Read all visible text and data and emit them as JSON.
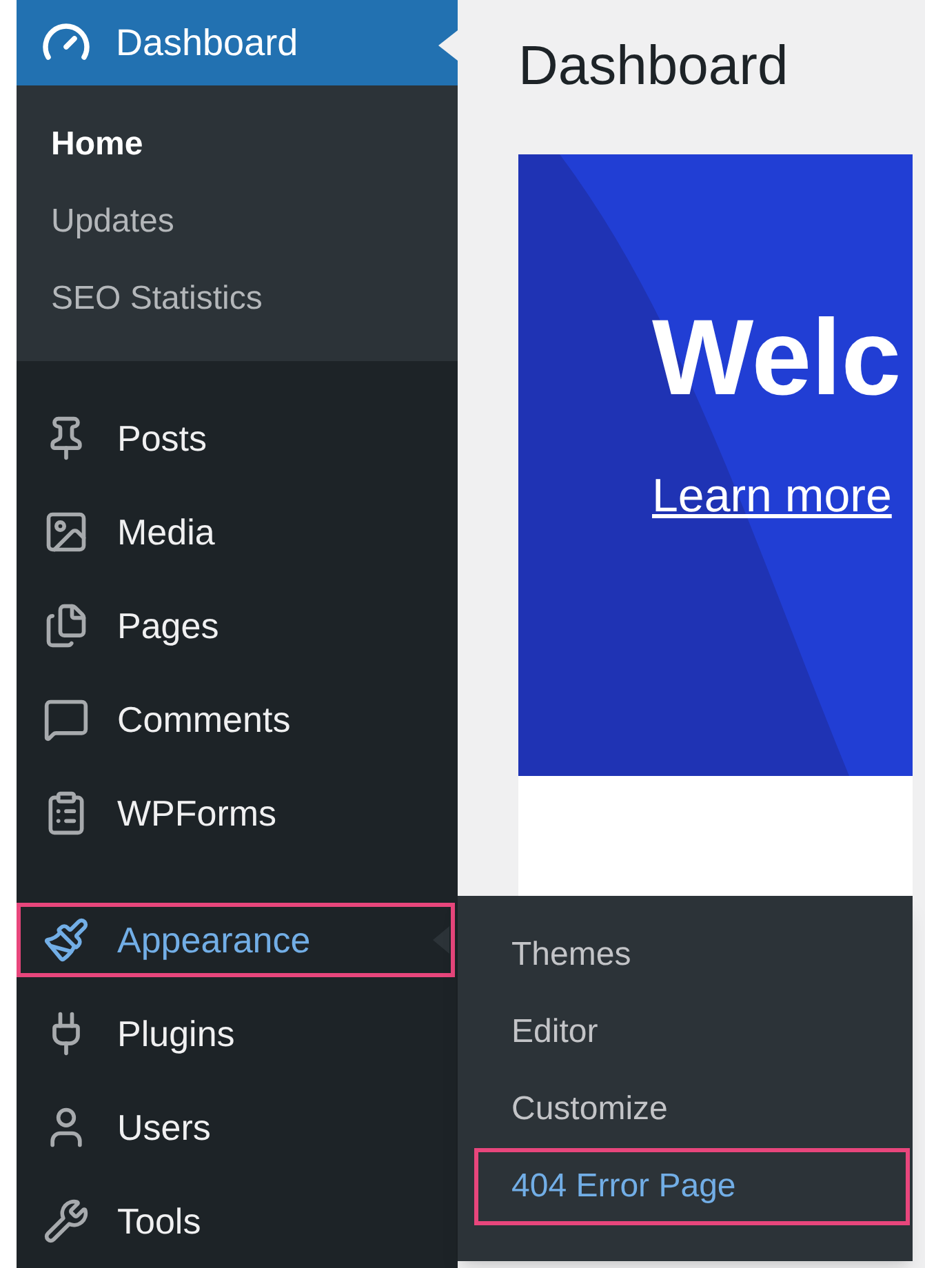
{
  "sidebar": {
    "header": {
      "label": "Dashboard",
      "selected": true
    },
    "submenu": [
      {
        "label": "Home",
        "selected": true
      },
      {
        "label": "Updates",
        "selected": false
      },
      {
        "label": "SEO Statistics",
        "selected": false
      }
    ],
    "menu_groups": [
      [
        {
          "label": "Posts",
          "kind": "pin",
          "highlighted": false,
          "hovered": false
        },
        {
          "label": "Media",
          "kind": "media",
          "highlighted": false,
          "hovered": false
        },
        {
          "label": "Pages",
          "kind": "pages",
          "highlighted": false,
          "hovered": false
        },
        {
          "label": "Comments",
          "kind": "comment",
          "highlighted": false,
          "hovered": false
        },
        {
          "label": "WPForms",
          "kind": "form",
          "highlighted": false,
          "hovered": false
        }
      ],
      [
        {
          "label": "Appearance",
          "kind": "brush",
          "highlighted": true,
          "hovered": true
        },
        {
          "label": "Plugins",
          "kind": "plug",
          "highlighted": false,
          "hovered": false
        },
        {
          "label": "Users",
          "kind": "user",
          "highlighted": false,
          "hovered": false
        },
        {
          "label": "Tools",
          "kind": "wrench",
          "highlighted": false,
          "hovered": false
        }
      ]
    ]
  },
  "flyout": [
    {
      "label": "Themes",
      "highlighted": false,
      "hovered": false
    },
    {
      "label": "Editor",
      "highlighted": false,
      "hovered": false
    },
    {
      "label": "Customize",
      "highlighted": false,
      "hovered": false
    },
    {
      "label": "404 Error Page",
      "highlighted": true,
      "hovered": true
    }
  ],
  "main": {
    "title": "Dashboard",
    "welcome": {
      "heading": "Welc",
      "link": "Learn more"
    }
  }
}
